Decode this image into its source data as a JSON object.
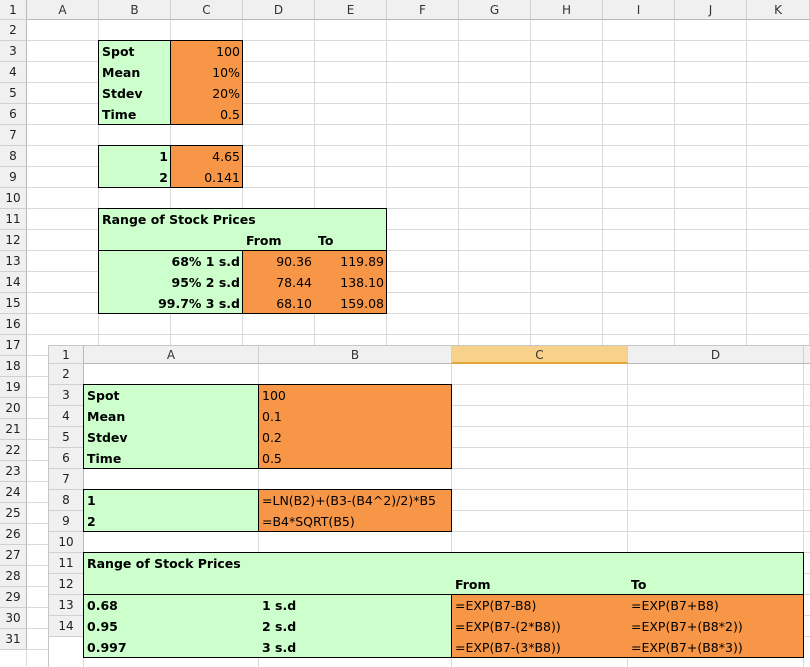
{
  "sheet1": {
    "columns": [
      "A",
      "B",
      "C",
      "D",
      "E",
      "F",
      "G",
      "H",
      "I",
      "J",
      "K"
    ],
    "rows": [
      "1",
      "2",
      "3",
      "4",
      "5",
      "6",
      "7",
      "8",
      "9",
      "10",
      "11",
      "12",
      "13",
      "14",
      "15",
      "16",
      "17",
      "18",
      "19",
      "20",
      "21",
      "22",
      "23",
      "24",
      "25",
      "26",
      "27",
      "28",
      "29",
      "30",
      "31"
    ],
    "labels": {
      "spot": "Spot",
      "mean": "Mean",
      "stdev": "Stdev",
      "time": "Time",
      "spot_val": "100",
      "mean_val": "10%",
      "stdev_val": "20%",
      "time_val": "0.5",
      "r7_a": "1",
      "r7_b": "4.65",
      "r8_a": "2",
      "r8_b": "0.141",
      "range_title": "Range of Stock Prices",
      "from": "From",
      "to": "To",
      "r12_a": "68% 1 s.d",
      "r12_from": "90.36",
      "r12_to": "119.89",
      "r13_a": "95% 2 s.d",
      "r13_from": "78.44",
      "r13_to": "138.10",
      "r14_a": "99.7% 3 s.d",
      "r14_from": "68.10",
      "r14_to": "159.08"
    }
  },
  "sheet2": {
    "columns": [
      "A",
      "B",
      "C",
      "D"
    ],
    "rows": [
      "1",
      "2",
      "3",
      "4",
      "5",
      "6",
      "7",
      "8",
      "9",
      "10",
      "11",
      "12",
      "13",
      "14"
    ],
    "labels": {
      "spot": "Spot",
      "mean": "Mean",
      "stdev": "Stdev",
      "time": "Time",
      "spot_val": "100",
      "mean_val": "0.1",
      "stdev_val": "0.2",
      "time_val": "0.5",
      "r7_a": "1",
      "r7_b": "=LN(B2)+(B3-(B4^2)/2)*B5",
      "r8_a": "2",
      "r8_b": "=B4*SQRT(B5)",
      "range_title": "Range of Stock Prices",
      "from": "From",
      "to": "To",
      "r12_a": "0.68",
      "r12_b": "1 s.d",
      "r12_from": "=EXP(B7-B8)",
      "r12_to": "=EXP(B7+B8)",
      "r13_a": "0.95",
      "r13_b": "2 s.d",
      "r13_from": "=EXP(B7-(2*B8))",
      "r13_to": "=EXP(B7+(B8*2))",
      "r14_a": "0.997",
      "r14_b": "3 s.d",
      "r14_from": "=EXP(B7-(3*B8))",
      "r14_to": "=EXP(B7+(B8*3))"
    },
    "selected_column": "C"
  },
  "colors": {
    "green": "#ccffcc",
    "orange": "#f79646"
  }
}
